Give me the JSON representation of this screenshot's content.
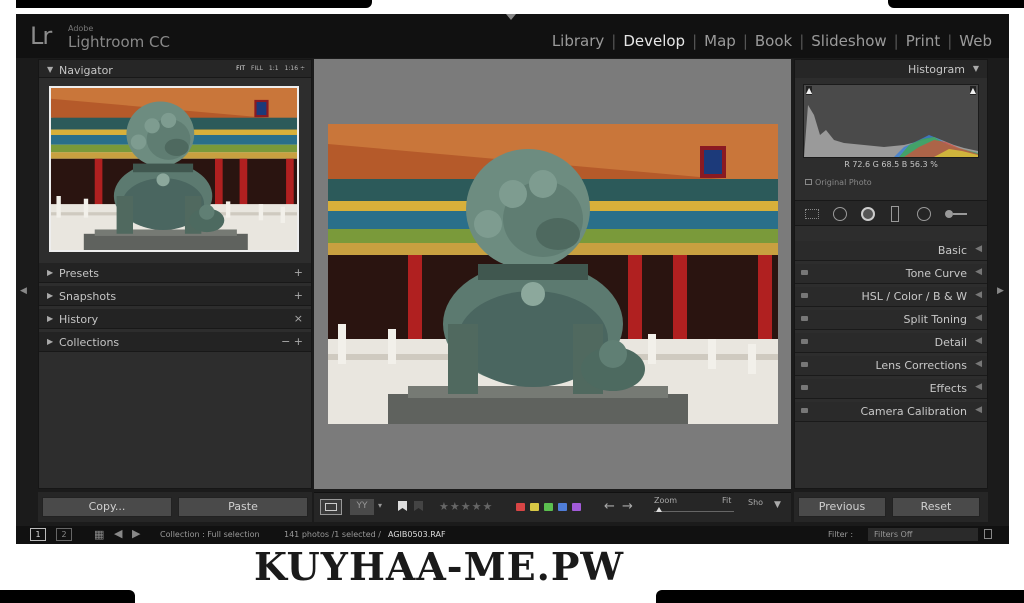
{
  "brand": {
    "logo": "Lr",
    "adobe": "Adobe",
    "product": "Lightroom CC"
  },
  "modules": [
    {
      "label": "Library",
      "active": false
    },
    {
      "label": "Develop",
      "active": true
    },
    {
      "label": "Map",
      "active": false
    },
    {
      "label": "Book",
      "active": false
    },
    {
      "label": "Slideshow",
      "active": false
    },
    {
      "label": "Print",
      "active": false
    },
    {
      "label": "Web",
      "active": false
    }
  ],
  "left_panel": {
    "navigator": {
      "title": "Navigator",
      "zoom": [
        "FIT",
        "FILL",
        "1:1",
        "1:16 ÷"
      ]
    },
    "sections": [
      {
        "label": "Presets",
        "action": "+"
      },
      {
        "label": "Snapshots",
        "action": "+"
      },
      {
        "label": "History",
        "action": "×"
      },
      {
        "label": "Collections",
        "action": "− +"
      }
    ],
    "copy_label": "Copy...",
    "paste_label": "Paste"
  },
  "right_panel": {
    "histogram_title": "Histogram",
    "readout": {
      "r_label": "R",
      "r": "72.6",
      "g_label": "G",
      "g": "68.5",
      "b_label": "B",
      "b": "56.3",
      "unit": "%"
    },
    "original_photo": "Original Photo",
    "sections": [
      {
        "label": "Basic"
      },
      {
        "label": "Tone Curve"
      },
      {
        "label": "HSL / Color / B & W"
      },
      {
        "label": "Split Toning"
      },
      {
        "label": "Detail"
      },
      {
        "label": "Lens Corrections"
      },
      {
        "label": "Effects"
      },
      {
        "label": "Camera Calibration"
      }
    ],
    "previous_label": "Previous",
    "reset_label": "Reset"
  },
  "toolbar": {
    "stars": "★★★★★",
    "color_labels": [
      "#d84545",
      "#d8c845",
      "#5bbf4f",
      "#4f7dd8",
      "#a25bd8"
    ],
    "zoom_label": "Zoom",
    "fit_label": "Fit",
    "show_label": "Sho"
  },
  "filmstrip": {
    "page1": "1",
    "page2": "2",
    "source": "Collection : Full selection",
    "count": "141 photos /1 selected /",
    "filename": "AGIB0503.RAF",
    "filter_label": "Filter :",
    "filter_value": "Filters Off"
  },
  "watermark": "KUYHAA-ME.PW",
  "colors": {
    "panel": "#2d2d2d",
    "center": "#7b7b7b",
    "chrome": "#111111"
  }
}
